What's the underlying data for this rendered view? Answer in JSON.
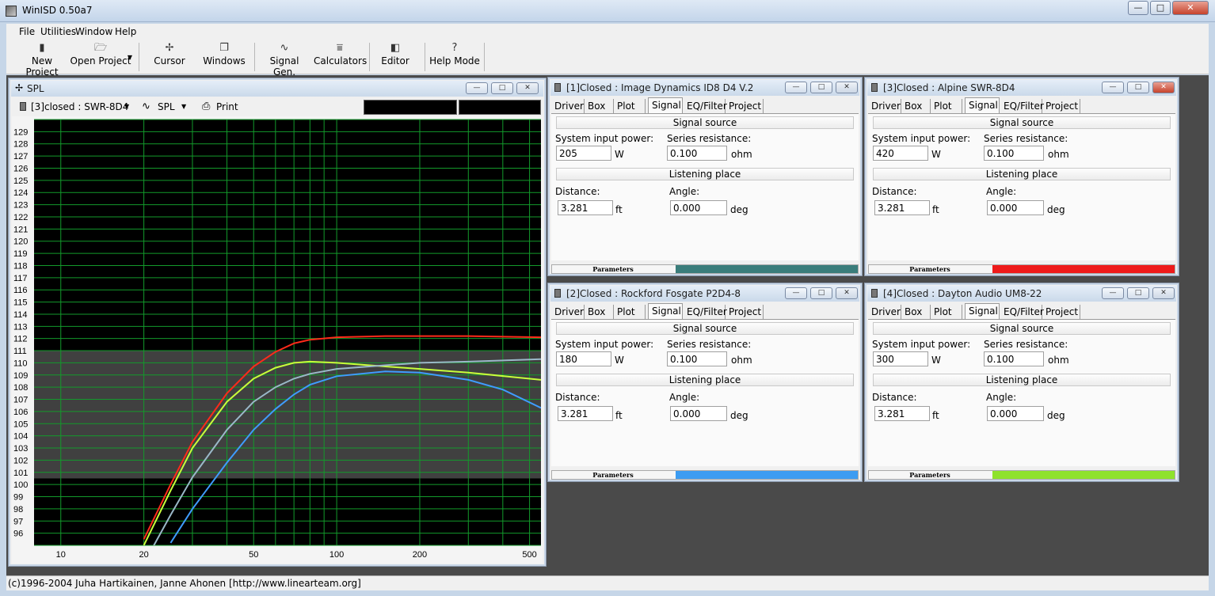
{
  "app": {
    "title": "WinISD 0.50a7",
    "window_buttons": {
      "minimize": "—",
      "maximize": "□",
      "close": "✕"
    }
  },
  "menu": [
    "File",
    "Utilities",
    "Window",
    "Help"
  ],
  "toolbar": [
    {
      "label": "New Project",
      "icon": "new-project-icon",
      "glyph": "▮"
    },
    {
      "label": "Open Project",
      "icon": "open-folder-icon",
      "glyph": "🗁"
    },
    {
      "label": "Cursor",
      "icon": "cursor-icon",
      "glyph": "✢"
    },
    {
      "label": "Windows",
      "icon": "windows-icon",
      "glyph": "❐"
    },
    {
      "label": "Signal Gen.",
      "icon": "sine-wave-icon",
      "glyph": "∿"
    },
    {
      "label": "Calculators",
      "icon": "calculator-icon",
      "glyph": "⩸"
    },
    {
      "label": "Editor",
      "icon": "editor-icon",
      "glyph": "◧"
    },
    {
      "label": "Help Mode",
      "icon": "help-icon",
      "glyph": "?"
    }
  ],
  "status": "(c)1996-2004 Juha Hartikainen, Janne Ahonen [http://www.linearteam.org]",
  "spl_window": {
    "title": "SPL",
    "project_selector": "[3]closed : SWR-8D4",
    "plot_selector": "SPL",
    "print_label": "Print"
  },
  "chart_data": {
    "type": "line",
    "xscale": "log",
    "xlim": [
      8,
      550
    ],
    "ylim": [
      95,
      130
    ],
    "x_ticks": [
      10,
      20,
      50,
      100,
      200,
      500
    ],
    "y_ticks": [
      96,
      97,
      98,
      99,
      100,
      101,
      102,
      103,
      104,
      105,
      106,
      107,
      108,
      109,
      110,
      111,
      112,
      113,
      114,
      115,
      116,
      117,
      118,
      119,
      120,
      121,
      122,
      123,
      124,
      125,
      126,
      127,
      128,
      129
    ],
    "grid": true,
    "highlight_band": [
      100.5,
      111
    ],
    "series": [
      {
        "color": "#ff2a1a",
        "x": [
          20,
          25,
          30,
          40,
          50,
          60,
          70,
          80,
          100,
          150,
          200,
          300,
          550
        ],
        "y": [
          95.5,
          100,
          103.5,
          107.5,
          109.7,
          110.9,
          111.6,
          111.9,
          112.1,
          112.2,
          112.2,
          112.2,
          112.1
        ]
      },
      {
        "color": "#c8ff3a",
        "x": [
          20,
          25,
          30,
          40,
          50,
          60,
          70,
          80,
          100,
          150,
          200,
          300,
          550
        ],
        "y": [
          95.0,
          99.5,
          103.0,
          106.8,
          108.7,
          109.6,
          110.0,
          110.1,
          110.0,
          109.7,
          109.5,
          109.2,
          108.6
        ]
      },
      {
        "color": "#9ab8c8",
        "x": [
          20,
          25,
          30,
          40,
          50,
          60,
          70,
          80,
          100,
          150,
          200,
          300,
          550
        ],
        "y": [
          93.5,
          97.5,
          100.6,
          104.5,
          106.8,
          108.0,
          108.7,
          109.1,
          109.5,
          109.8,
          110.0,
          110.1,
          110.3
        ]
      },
      {
        "color": "#3f9cff",
        "x": [
          25,
          30,
          40,
          50,
          60,
          70,
          80,
          100,
          150,
          200,
          300,
          400,
          550
        ],
        "y": [
          95.2,
          98.0,
          101.8,
          104.5,
          106.2,
          107.4,
          108.2,
          108.9,
          109.3,
          109.2,
          108.6,
          107.8,
          106.3
        ]
      }
    ]
  },
  "projects": [
    {
      "title": "[1]Closed : Image Dynamics ID8 D4 V.2",
      "power": "205",
      "resistance": "0.100",
      "distance": "3.281",
      "angle": "0.000",
      "color": "#3a7d7b",
      "close_hot": false
    },
    {
      "title": "[3]Closed : Alpine SWR-8D4",
      "power": "420",
      "resistance": "0.100",
      "distance": "3.281",
      "angle": "0.000",
      "color": "#ee1a1a",
      "close_hot": true
    },
    {
      "title": "[2]Closed : Rockford Fosgate P2D4-8",
      "power": "180",
      "resistance": "0.100",
      "distance": "3.281",
      "angle": "0.000",
      "color": "#3d9cf2",
      "close_hot": false
    },
    {
      "title": "[4]Closed : Dayton Audio UM8-22",
      "power": "300",
      "resistance": "0.100",
      "distance": "3.281",
      "angle": "0.000",
      "color": "#8fe22c",
      "close_hot": false
    }
  ],
  "panel_labels": {
    "tabs": [
      "Driver",
      "Box",
      "Plot",
      "Signal",
      "EQ/Filter",
      "Project"
    ],
    "signal_source": "Signal source",
    "system_input_power": "System input power:",
    "series_resistance": "Series resistance:",
    "unit_w": "W",
    "unit_ohm": "ohm",
    "listening_place": "Listening place",
    "distance": "Distance:",
    "angle": "Angle:",
    "unit_ft": "ft",
    "unit_deg": "deg",
    "parameters": "Parameters"
  }
}
